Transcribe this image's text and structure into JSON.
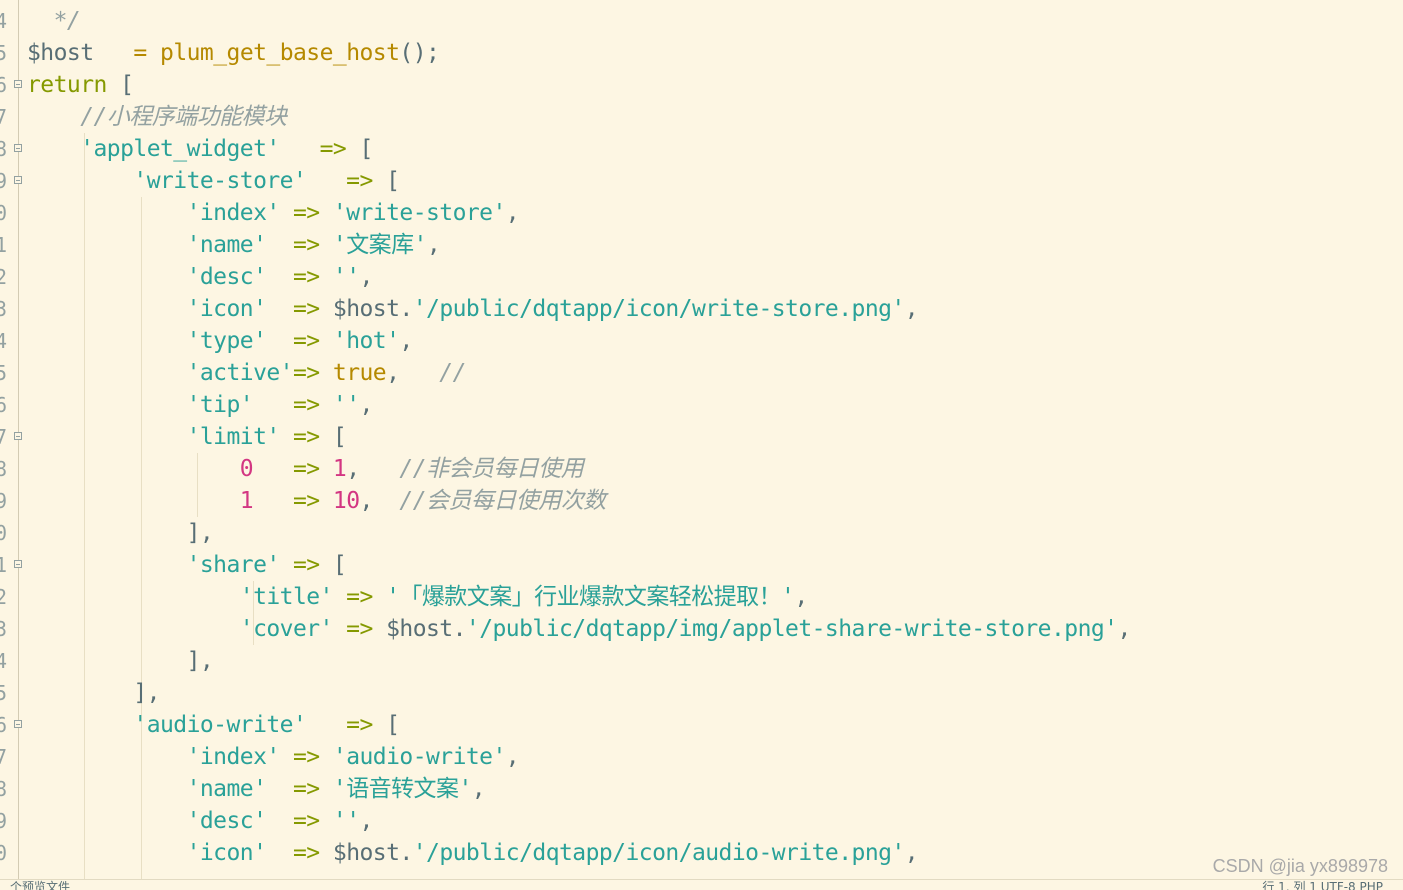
{
  "editor": {
    "lines": [
      {
        "num": "4",
        "fold": false,
        "segs": [
          [
            "c",
            "  */"
          ]
        ]
      },
      {
        "num": "5",
        "fold": false,
        "segs": [
          [
            "v",
            "$host"
          ],
          [
            "p",
            "   "
          ],
          [
            "op",
            "="
          ],
          [
            "p",
            " "
          ],
          [
            "f",
            "plum_get_base_host"
          ],
          [
            "p",
            "();"
          ]
        ]
      },
      {
        "num": "6",
        "fold": true,
        "segs": [
          [
            "k",
            "return"
          ],
          [
            "p",
            " ["
          ]
        ]
      },
      {
        "num": "7",
        "fold": false,
        "segs": [
          [
            "p",
            "    "
          ],
          [
            "c",
            "//小程序端功能模块"
          ]
        ]
      },
      {
        "num": "8",
        "fold": true,
        "segs": [
          [
            "p",
            "    "
          ],
          [
            "s",
            "'applet_widget'"
          ],
          [
            "p",
            "   "
          ],
          [
            "k",
            "=>"
          ],
          [
            "p",
            " ["
          ]
        ]
      },
      {
        "num": "9",
        "fold": true,
        "segs": [
          [
            "p",
            "        "
          ],
          [
            "s",
            "'write-store'"
          ],
          [
            "p",
            "   "
          ],
          [
            "k",
            "=>"
          ],
          [
            "p",
            " ["
          ]
        ]
      },
      {
        "num": "0",
        "fold": false,
        "segs": [
          [
            "p",
            "            "
          ],
          [
            "s",
            "'index'"
          ],
          [
            "p",
            " "
          ],
          [
            "k",
            "=>"
          ],
          [
            "p",
            " "
          ],
          [
            "s",
            "'write-store'"
          ],
          [
            "p",
            ","
          ]
        ]
      },
      {
        "num": "1",
        "fold": false,
        "segs": [
          [
            "p",
            "            "
          ],
          [
            "s",
            "'name'"
          ],
          [
            "p",
            "  "
          ],
          [
            "k",
            "=>"
          ],
          [
            "p",
            " "
          ],
          [
            "s",
            "'文案库'"
          ],
          [
            "p",
            ","
          ]
        ]
      },
      {
        "num": "2",
        "fold": false,
        "segs": [
          [
            "p",
            "            "
          ],
          [
            "s",
            "'desc'"
          ],
          [
            "p",
            "  "
          ],
          [
            "k",
            "=>"
          ],
          [
            "p",
            " "
          ],
          [
            "s",
            "''"
          ],
          [
            "p",
            ","
          ]
        ]
      },
      {
        "num": "3",
        "fold": false,
        "segs": [
          [
            "p",
            "            "
          ],
          [
            "s",
            "'icon'"
          ],
          [
            "p",
            "  "
          ],
          [
            "k",
            "=>"
          ],
          [
            "p",
            " "
          ],
          [
            "v",
            "$host"
          ],
          [
            "p",
            "."
          ],
          [
            "s",
            "'/public/dqtapp/icon/write-store.png'"
          ],
          [
            "p",
            ","
          ]
        ]
      },
      {
        "num": "4",
        "fold": false,
        "segs": [
          [
            "p",
            "            "
          ],
          [
            "s",
            "'type'"
          ],
          [
            "p",
            "  "
          ],
          [
            "k",
            "=>"
          ],
          [
            "p",
            " "
          ],
          [
            "s",
            "'hot'"
          ],
          [
            "p",
            ","
          ]
        ]
      },
      {
        "num": "5",
        "fold": false,
        "segs": [
          [
            "p",
            "            "
          ],
          [
            "s",
            "'active'"
          ],
          [
            "k",
            "=>"
          ],
          [
            "p",
            " "
          ],
          [
            "op",
            "true"
          ],
          [
            "p",
            ",   "
          ],
          [
            "c",
            "//"
          ]
        ]
      },
      {
        "num": "6",
        "fold": false,
        "segs": [
          [
            "p",
            "            "
          ],
          [
            "s",
            "'tip'"
          ],
          [
            "p",
            "   "
          ],
          [
            "k",
            "=>"
          ],
          [
            "p",
            " "
          ],
          [
            "s",
            "''"
          ],
          [
            "p",
            ","
          ]
        ]
      },
      {
        "num": "7",
        "fold": true,
        "segs": [
          [
            "p",
            "            "
          ],
          [
            "s",
            "'limit'"
          ],
          [
            "p",
            " "
          ],
          [
            "k",
            "=>"
          ],
          [
            "p",
            " ["
          ]
        ]
      },
      {
        "num": "8",
        "fold": false,
        "segs": [
          [
            "p",
            "                "
          ],
          [
            "n",
            "0"
          ],
          [
            "p",
            "   "
          ],
          [
            "k",
            "=>"
          ],
          [
            "p",
            " "
          ],
          [
            "n",
            "1"
          ],
          [
            "p",
            ",   "
          ],
          [
            "c",
            "//非会员每日使用"
          ]
        ]
      },
      {
        "num": "9",
        "fold": false,
        "segs": [
          [
            "p",
            "                "
          ],
          [
            "n",
            "1"
          ],
          [
            "p",
            "   "
          ],
          [
            "k",
            "=>"
          ],
          [
            "p",
            " "
          ],
          [
            "n",
            "10"
          ],
          [
            "p",
            ",  "
          ],
          [
            "c",
            "//会员每日使用次数"
          ]
        ]
      },
      {
        "num": "0",
        "fold": false,
        "segs": [
          [
            "p",
            "            ],"
          ]
        ]
      },
      {
        "num": "1",
        "fold": true,
        "segs": [
          [
            "p",
            "            "
          ],
          [
            "s",
            "'share'"
          ],
          [
            "p",
            " "
          ],
          [
            "k",
            "=>"
          ],
          [
            "p",
            " ["
          ]
        ]
      },
      {
        "num": "2",
        "fold": false,
        "segs": [
          [
            "p",
            "                "
          ],
          [
            "s",
            "'title'"
          ],
          [
            "p",
            " "
          ],
          [
            "k",
            "=>"
          ],
          [
            "p",
            " "
          ],
          [
            "s",
            "'「爆款文案」行业爆款文案轻松提取！'"
          ],
          [
            "p",
            ","
          ]
        ]
      },
      {
        "num": "3",
        "fold": false,
        "segs": [
          [
            "p",
            "                "
          ],
          [
            "s",
            "'cover'"
          ],
          [
            "p",
            " "
          ],
          [
            "k",
            "=>"
          ],
          [
            "p",
            " "
          ],
          [
            "v",
            "$host"
          ],
          [
            "p",
            "."
          ],
          [
            "s",
            "'/public/dqtapp/img/applet-share-write-store.png'"
          ],
          [
            "p",
            ","
          ]
        ]
      },
      {
        "num": "4",
        "fold": false,
        "segs": [
          [
            "p",
            "            ],"
          ]
        ]
      },
      {
        "num": "5",
        "fold": false,
        "segs": [
          [
            "p",
            "        ],"
          ]
        ]
      },
      {
        "num": "6",
        "fold": true,
        "segs": [
          [
            "p",
            "        "
          ],
          [
            "s",
            "'audio-write'"
          ],
          [
            "p",
            "   "
          ],
          [
            "k",
            "=>"
          ],
          [
            "p",
            " ["
          ]
        ]
      },
      {
        "num": "7",
        "fold": false,
        "segs": [
          [
            "p",
            "            "
          ],
          [
            "s",
            "'index'"
          ],
          [
            "p",
            " "
          ],
          [
            "k",
            "=>"
          ],
          [
            "p",
            " "
          ],
          [
            "s",
            "'audio-write'"
          ],
          [
            "p",
            ","
          ]
        ]
      },
      {
        "num": "8",
        "fold": false,
        "segs": [
          [
            "p",
            "            "
          ],
          [
            "s",
            "'name'"
          ],
          [
            "p",
            "  "
          ],
          [
            "k",
            "=>"
          ],
          [
            "p",
            " "
          ],
          [
            "s",
            "'语音转文案'"
          ],
          [
            "p",
            ","
          ]
        ]
      },
      {
        "num": "9",
        "fold": false,
        "segs": [
          [
            "p",
            "            "
          ],
          [
            "s",
            "'desc'"
          ],
          [
            "p",
            "  "
          ],
          [
            "k",
            "=>"
          ],
          [
            "p",
            " "
          ],
          [
            "s",
            "''"
          ],
          [
            "p",
            ","
          ]
        ]
      },
      {
        "num": "0",
        "fold": false,
        "segs": [
          [
            "p",
            "            "
          ],
          [
            "s",
            "'icon'"
          ],
          [
            "p",
            "  "
          ],
          [
            "k",
            "=>"
          ],
          [
            "p",
            " "
          ],
          [
            "v",
            "$host"
          ],
          [
            "p",
            "."
          ],
          [
            "s",
            "'/public/dqtapp/icon/audio-write.png'"
          ],
          [
            "p",
            ","
          ]
        ]
      }
    ]
  },
  "status_bar": {
    "left": "个预览文件",
    "right": "行 1, 列 1    UTF-8    PHP"
  },
  "watermark": "CSDN @jia     yx898978"
}
